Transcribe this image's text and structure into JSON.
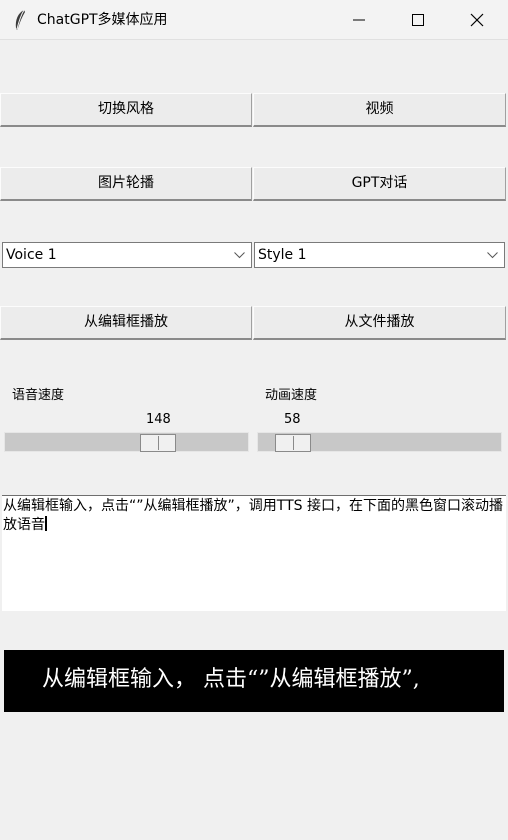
{
  "window": {
    "title": "ChatGPT多媒体应用",
    "icon": "feather-icon"
  },
  "buttons": {
    "switch_style": "切换风格",
    "video": "视频",
    "slideshow": "图片轮播",
    "gpt_chat": "GPT对话",
    "play_from_editor": "从编辑框播放",
    "play_from_file": "从文件播放"
  },
  "selects": {
    "voice": {
      "value": "Voice 1"
    },
    "style": {
      "value": "Style 1"
    }
  },
  "sliders": {
    "voice_speed": {
      "label": "语音速度",
      "value": "148"
    },
    "animation_speed": {
      "label": "动画速度",
      "value": "58"
    }
  },
  "editor": {
    "text": "从编辑框输入，点击“”从编辑框播放”，调用TTS 接口，在下面的黑色窗口滚动播放语音"
  },
  "marquee": {
    "text": "从编辑框输入，  点击“”从编辑框播放”,"
  },
  "colors": {
    "background": "#f0f0f0",
    "marquee_bg": "#000000",
    "marquee_fg": "#ffffff"
  }
}
